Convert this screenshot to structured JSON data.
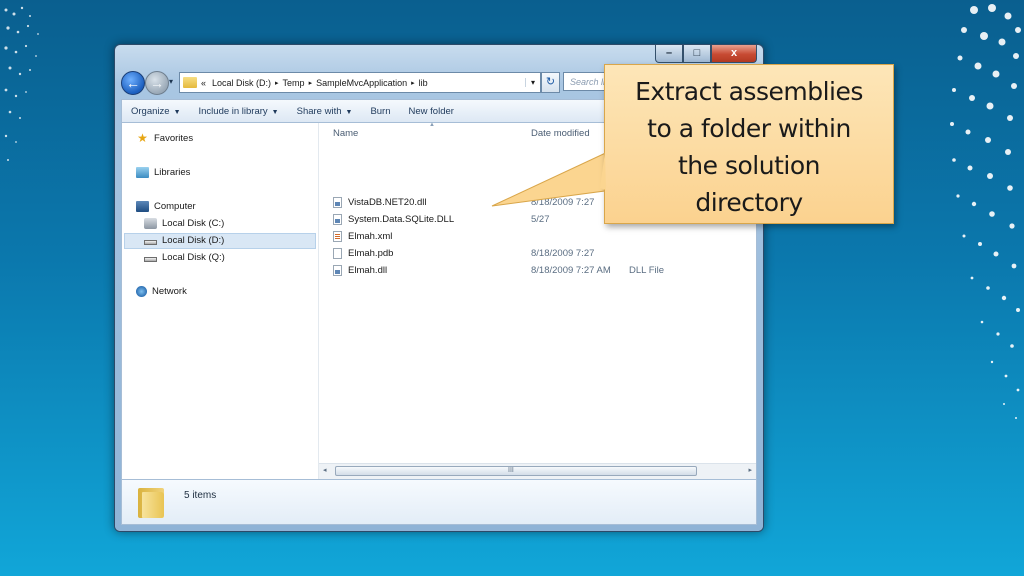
{
  "window": {
    "controls": {
      "minimize": "–",
      "maximize": "□",
      "close": "x"
    }
  },
  "address": {
    "recent_arrow": "▾",
    "overflow": "«",
    "crumbs": [
      "Local Disk (D:)",
      "Temp",
      "SampleMvcApplication",
      "lib"
    ],
    "separator": "▸",
    "dropdown": "▾",
    "refresh": "↻",
    "search_placeholder": "Search lib"
  },
  "toolbar": {
    "organize": "Organize",
    "include_in_library": "Include in library",
    "share_with": "Share with",
    "burn": "Burn",
    "new_folder": "New folder",
    "dropdown_arrow": "▼"
  },
  "nav": {
    "favorites": "Favorites",
    "libraries": "Libraries",
    "computer": "Computer",
    "disk_c": "Local Disk (C:)",
    "disk_d": "Local Disk (D:)",
    "disk_q": "Local Disk (Q:)",
    "network": "Network",
    "star_glyph": "★"
  },
  "files": {
    "columns": {
      "name": "Name",
      "date_modified": "Date modified"
    },
    "rows": [
      {
        "name": "VistaDB.NET20.dll",
        "date": "8/18/2009 7:27",
        "type": ""
      },
      {
        "name": "System.Data.SQLite.DLL",
        "date": "5/27",
        "type": ""
      },
      {
        "name": "Elmah.xml",
        "date": "",
        "type": ""
      },
      {
        "name": "Elmah.pdb",
        "date": "8/18/2009 7:27",
        "type": ""
      },
      {
        "name": "Elmah.dll",
        "date": "8/18/2009 7:27 AM",
        "type": "DLL File"
      }
    ]
  },
  "scrollbar": {
    "left": "◂",
    "right": "▸",
    "grip": "III"
  },
  "details": {
    "item_count": "5 items"
  },
  "callout": {
    "lines": [
      "Extract assemblies",
      "to a folder within",
      "the solution",
      "directory"
    ]
  },
  "colors": {
    "background_top": "#0a5f8f",
    "background_bottom": "#11a6d8",
    "callout_fill": "#fbd28f",
    "callout_border": "#d9a64a"
  }
}
